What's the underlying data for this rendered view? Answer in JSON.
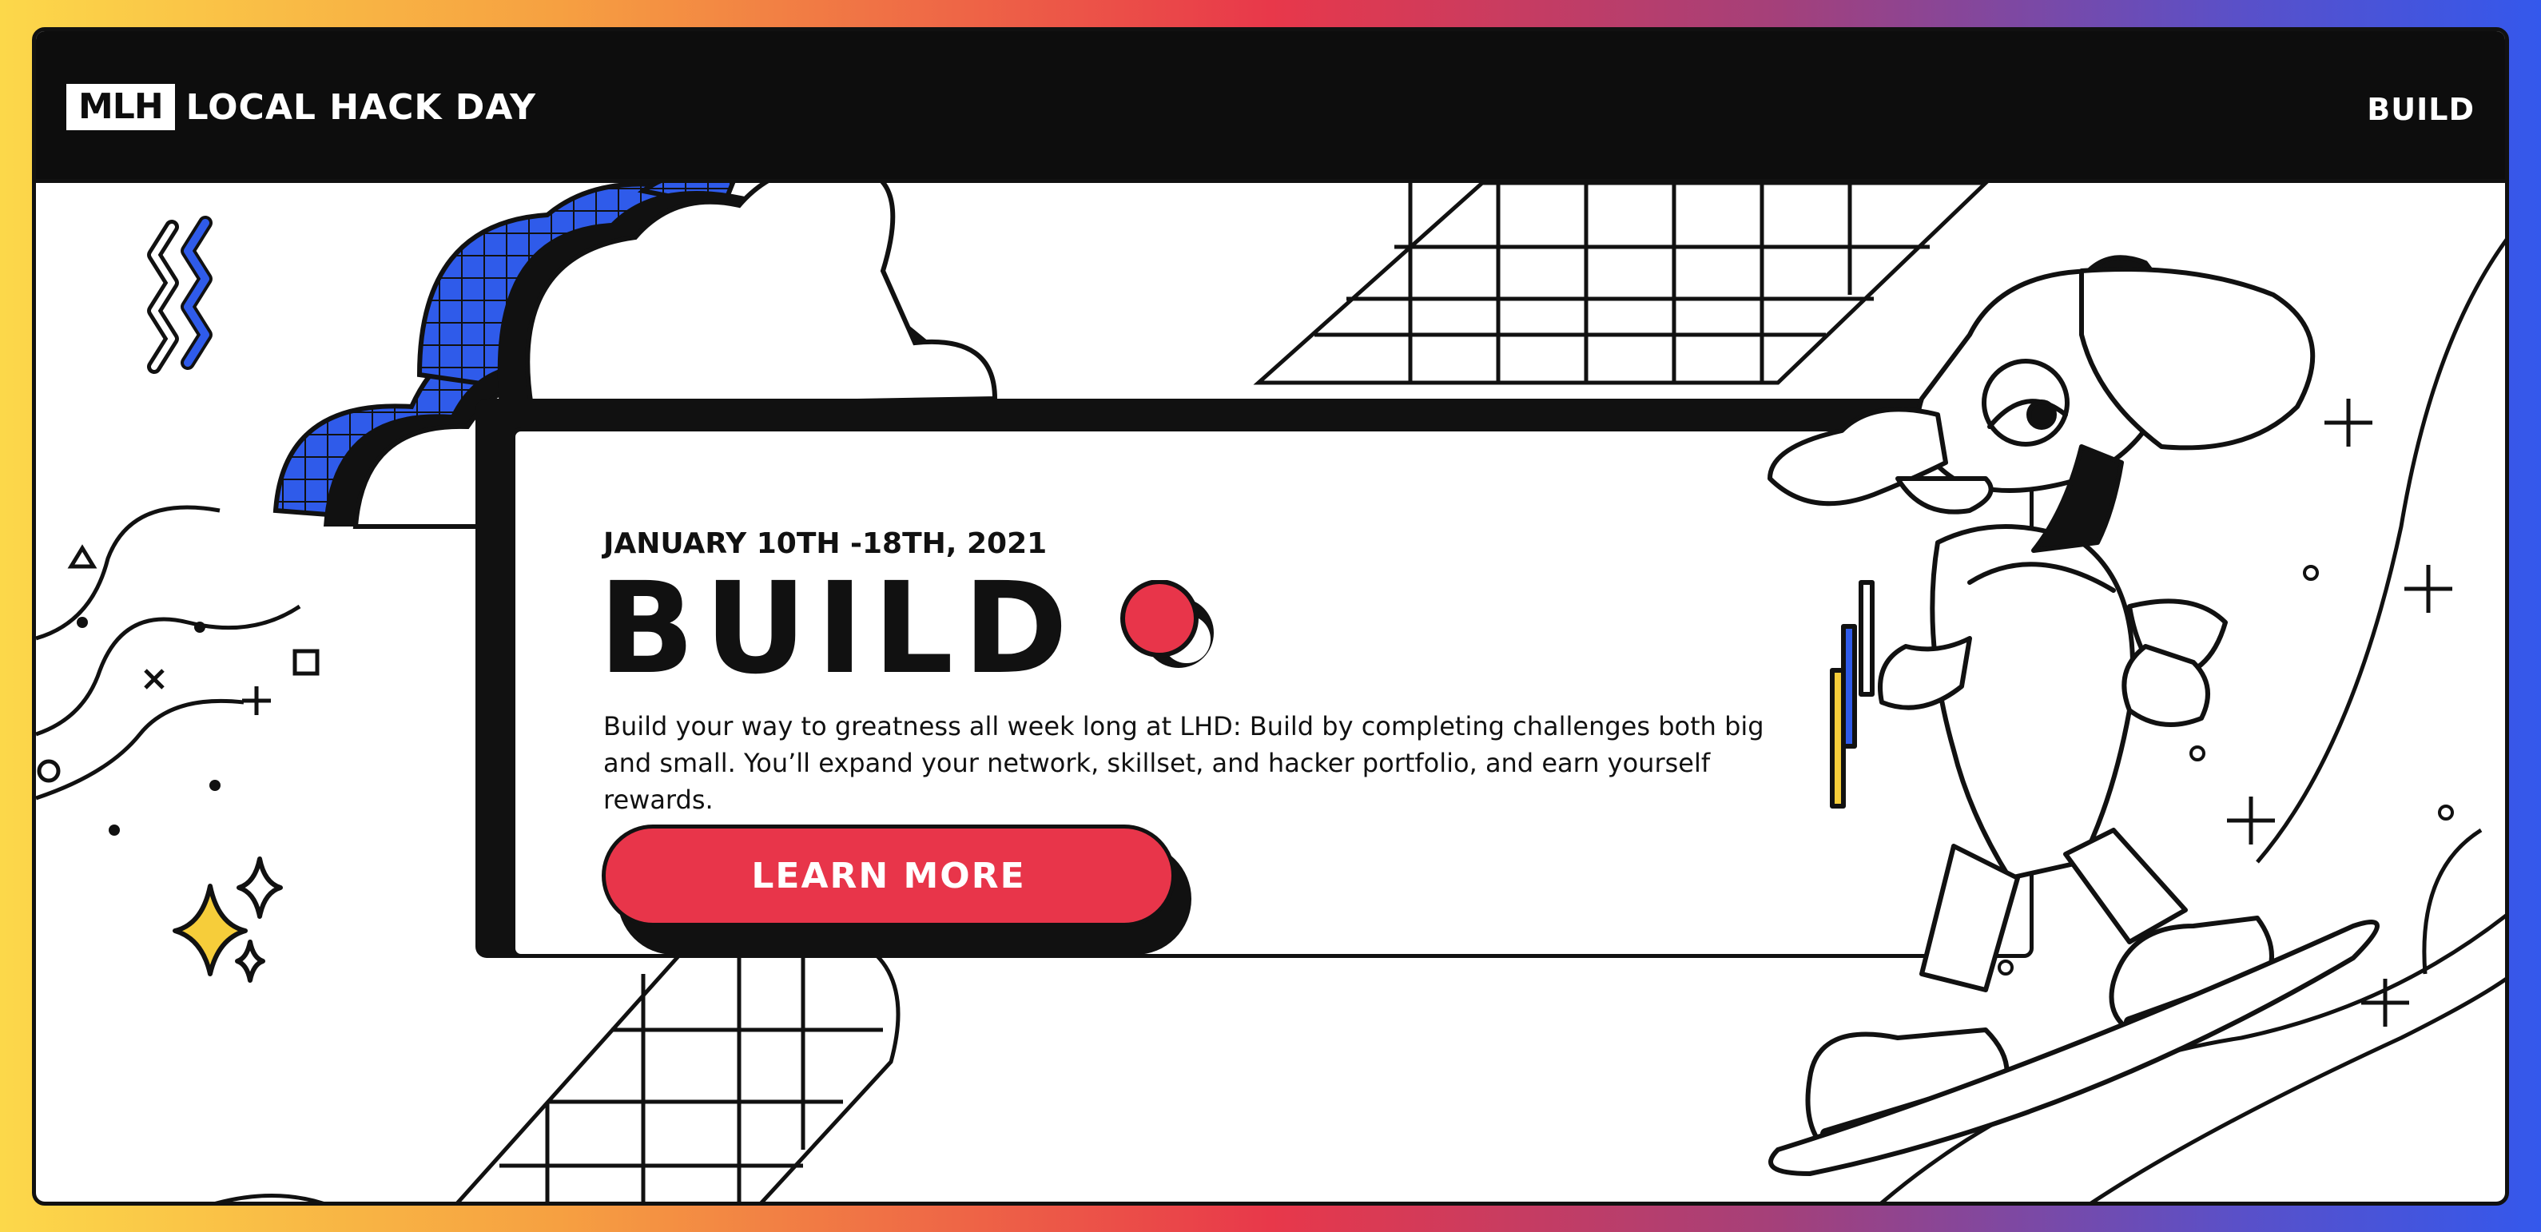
{
  "header": {
    "logo_mark": "MLH",
    "logo_text": "LOCAL HACK DAY",
    "nav_build": "BUILD"
  },
  "hero": {
    "date": "JANUARY 10TH -18TH, 2021",
    "title": "BUILD",
    "description": "Build your way to greatness all week long at LHD: Build by completing challenges both big and small. You’ll expand your network, skillset, and hacker portfolio, and earn yourself rewards.",
    "cta_label": "LEARN MORE"
  },
  "colors": {
    "accent_red": "#e8354a",
    "accent_blue": "#2f5bea",
    "accent_yellow": "#f6cd3a",
    "ink": "#111111"
  },
  "icons": [
    "zigzag-icon",
    "sparkle-icon",
    "cloud-icon",
    "grid-icon",
    "elephant-mascot-icon",
    "skateboard-icon",
    "plus-icon",
    "triangle-icon",
    "square-icon",
    "circle-icon",
    "x-icon"
  ]
}
